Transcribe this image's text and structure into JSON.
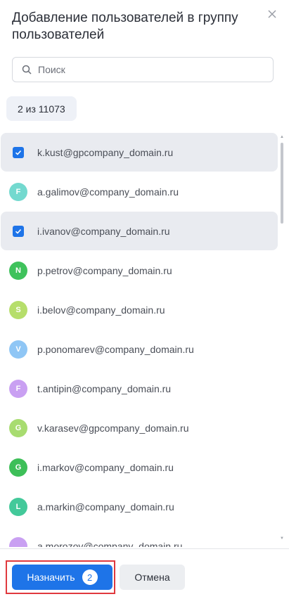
{
  "dialog": {
    "title": "Добавление пользователей в группу пользователей",
    "close_icon": "close-icon"
  },
  "search": {
    "placeholder": "Поиск",
    "value": ""
  },
  "counter": "2 из 11073",
  "users": [
    {
      "email": "k.kust@gpcompany_domain.ru",
      "selected": true,
      "initial": "",
      "color": "#1e74e8"
    },
    {
      "email": "a.galimov@company_domain.ru",
      "selected": false,
      "initial": "F",
      "color": "#73d9cf"
    },
    {
      "email": "i.ivanov@company_domain.ru",
      "selected": true,
      "initial": "",
      "color": "#1e74e8"
    },
    {
      "email": "p.petrov@company_domain.ru",
      "selected": false,
      "initial": "N",
      "color": "#3fc25c"
    },
    {
      "email": "i.belov@company_domain.ru",
      "selected": false,
      "initial": "S",
      "color": "#b6de6b"
    },
    {
      "email": "p.ponomarev@company_domain.ru",
      "selected": false,
      "initial": "V",
      "color": "#8fc6f5"
    },
    {
      "email": "t.antipin@company_domain.ru",
      "selected": false,
      "initial": "F",
      "color": "#c9a0f2"
    },
    {
      "email": "v.karasev@gpcompany_domain.ru",
      "selected": false,
      "initial": "G",
      "color": "#a8dc70"
    },
    {
      "email": "i.markov@company_domain.ru",
      "selected": false,
      "initial": "G",
      "color": "#3dbf58"
    },
    {
      "email": "a.markin@company_domain.ru",
      "selected": false,
      "initial": "L",
      "color": "#43c99a"
    },
    {
      "email": "a.morozov@company_domain.ru",
      "selected": false,
      "initial": "",
      "color": "#c9a0f2"
    }
  ],
  "footer": {
    "assign_label": "Назначить",
    "assign_count": "2",
    "cancel_label": "Отмена"
  }
}
